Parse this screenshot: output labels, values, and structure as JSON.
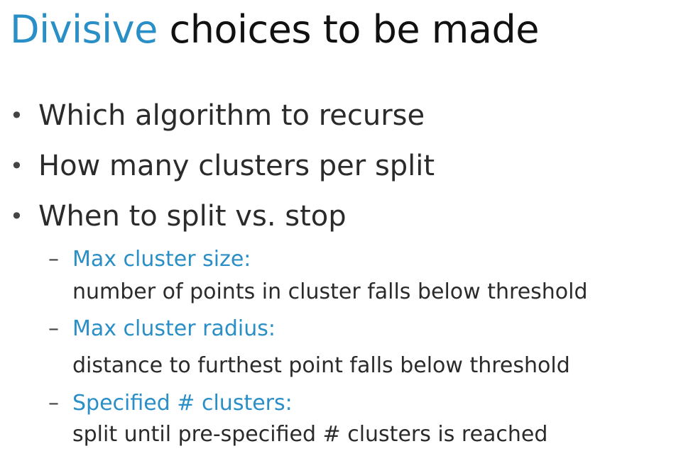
{
  "slide": {
    "title_accent": "Divisive",
    "title_rest": " choices to be made",
    "accent_color": "#2a8fc6",
    "bullets": [
      {
        "marker": "•",
        "text": "Which algorithm to recurse"
      },
      {
        "marker": "•",
        "text": "How many clusters per split"
      },
      {
        "marker": "•",
        "text": "When to split vs. stop"
      }
    ],
    "sub_items": [
      {
        "marker": "–",
        "label": "Max cluster size:",
        "desc": "number of points in cluster falls below threshold"
      },
      {
        "marker": "–",
        "label": "Max cluster radius:",
        "desc": "distance to furthest point falls below threshold"
      },
      {
        "marker": "–",
        "label": "Specified # clusters:",
        "desc": "split until pre-specified # clusters is reached"
      }
    ]
  }
}
